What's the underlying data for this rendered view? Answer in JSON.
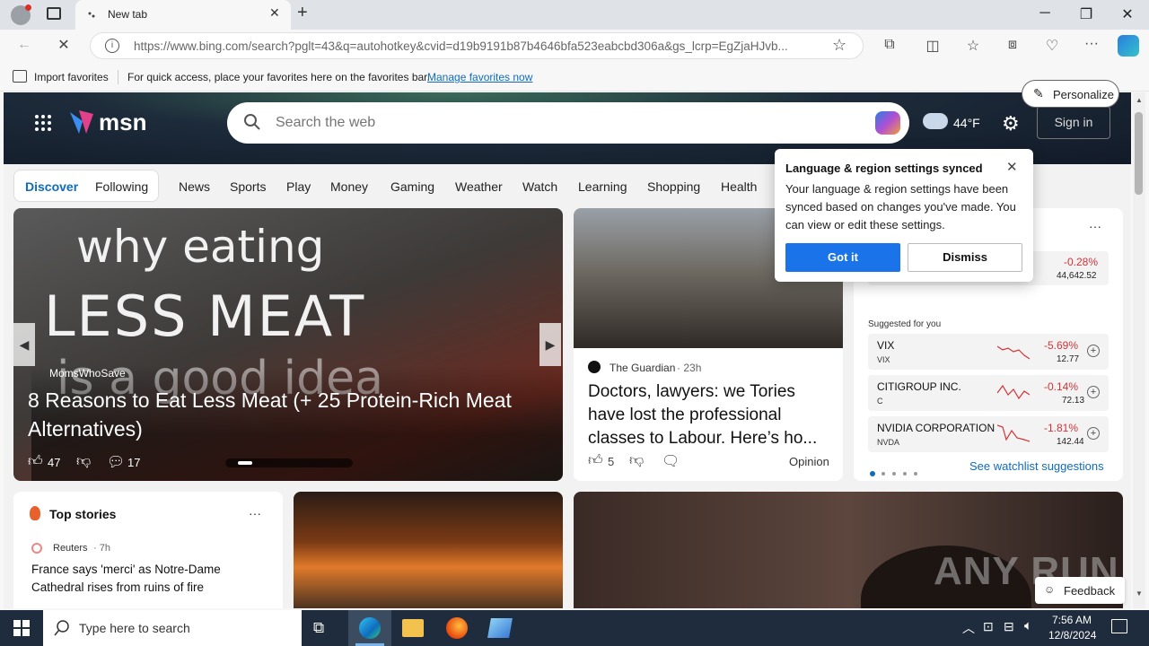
{
  "browser": {
    "tab_title": "New tab",
    "url": "https://www.bing.com/search?pglt=43&q=autohotkey&cvid=d19b9191b87b4646bfa523eabcbd306a&gs_lcrp=EgZjaHJvb..."
  },
  "favbar": {
    "import_label": "Import favorites",
    "hint": "For quick access, place your favorites here on the favorites bar.",
    "manage_link": "Manage favorites now"
  },
  "msn": {
    "logo": "msn",
    "search_placeholder": "Search the web",
    "weather_temp": "44",
    "weather_unit": "°F",
    "signin": "Sign in"
  },
  "nav": {
    "discover": "Discover",
    "following": "Following",
    "items": [
      "News",
      "Sports",
      "Play",
      "Money",
      "Gaming",
      "Weather",
      "Watch",
      "Learning",
      "Shopping",
      "Health"
    ],
    "personalize": "Personalize"
  },
  "hero": {
    "image_text_line1": "why eating",
    "image_text_line2": "LESS MEAT",
    "image_text_line3": "is a good idea",
    "source": "MomsWhoSave",
    "headline": "8 Reasons to Eat Less Meat (+ 25 Protein-Rich Meat Alternatives)",
    "likes": "47",
    "comments": "17"
  },
  "news_card": {
    "source": "The Guardian",
    "age": "23h",
    "headline": "Doctors, lawyers: we Tories have lost the professional classes to Labour. Here’s ho...",
    "likes": "5",
    "tag": "Opinion"
  },
  "stocks": {
    "top_change": "-0.28%",
    "top_value": "44,642.52",
    "suggested_label": "Suggested for you",
    "rows": [
      {
        "name": "VIX",
        "symbol": "VIX",
        "change": "-5.69%",
        "value": "12.77"
      },
      {
        "name": "CITIGROUP INC.",
        "symbol": "C",
        "change": "-0.14%",
        "value": "72.13"
      },
      {
        "name": "NVIDIA CORPORATION",
        "symbol": "NVDA",
        "change": "-1.81%",
        "value": "142.44"
      }
    ],
    "see_more": "See watchlist suggestions"
  },
  "popup": {
    "title": "Language & region settings synced",
    "body": "Your language & region settings have been synced based on changes you've made. You can view or edit these settings.",
    "got_it": "Got it",
    "dismiss": "Dismiss"
  },
  "top_stories": {
    "title": "Top stories",
    "source": "Reuters",
    "age": "7h",
    "headline": "France says 'merci' as Notre-Dame Cathedral rises from ruins of fire"
  },
  "feedback": "Feedback",
  "watermark": "ANY RUN",
  "taskbar": {
    "search_placeholder": "Type here to search",
    "time": "7:56 AM",
    "date": "12/8/2024"
  },
  "colors": {
    "accent": "#0f6cbd",
    "negative": "#d13438",
    "button_blue": "#1a73e8"
  }
}
